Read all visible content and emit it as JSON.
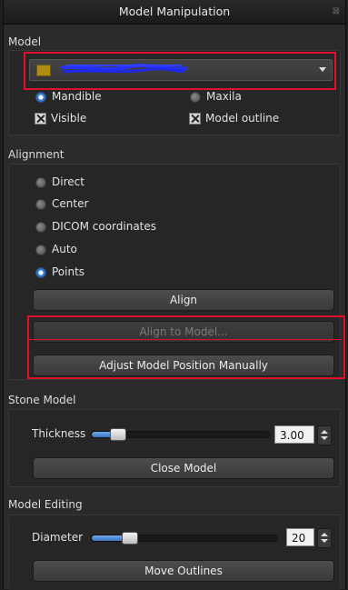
{
  "window": {
    "title": "Model Manipulation",
    "close_glyph": "⊠"
  },
  "model": {
    "section_label": "Model",
    "dropdown": {
      "value": "",
      "swatch_color": "#b18c12"
    },
    "jaw_options": [
      {
        "label": "Mandible",
        "selected": true
      },
      {
        "label": "Maxila",
        "selected": false
      }
    ],
    "visible_label": "Visible",
    "outline_label": "Model outline"
  },
  "alignment": {
    "section_label": "Alignment",
    "options": [
      {
        "label": "Direct",
        "selected": false
      },
      {
        "label": "Center",
        "selected": false
      },
      {
        "label": "DICOM coordinates",
        "selected": false
      },
      {
        "label": "Auto",
        "selected": false
      },
      {
        "label": "Points",
        "selected": true
      }
    ],
    "align_label": "Align",
    "align_to_model_label": "Align to Model...",
    "adjust_label": "Adjust Model Position Manually"
  },
  "stone": {
    "section_label": "Stone Model",
    "thickness_label": "Thickness",
    "thickness_value": "3.00",
    "thickness_fraction": 0.1,
    "close_label": "Close Model"
  },
  "editing": {
    "section_label": "Model Editing",
    "diameter_label": "Diameter",
    "diameter_value": "20",
    "diameter_fraction": 0.16,
    "move_label": "Move Outlines"
  },
  "colors": {
    "accent": "#3f86d8",
    "highlight": "#e0102a"
  }
}
